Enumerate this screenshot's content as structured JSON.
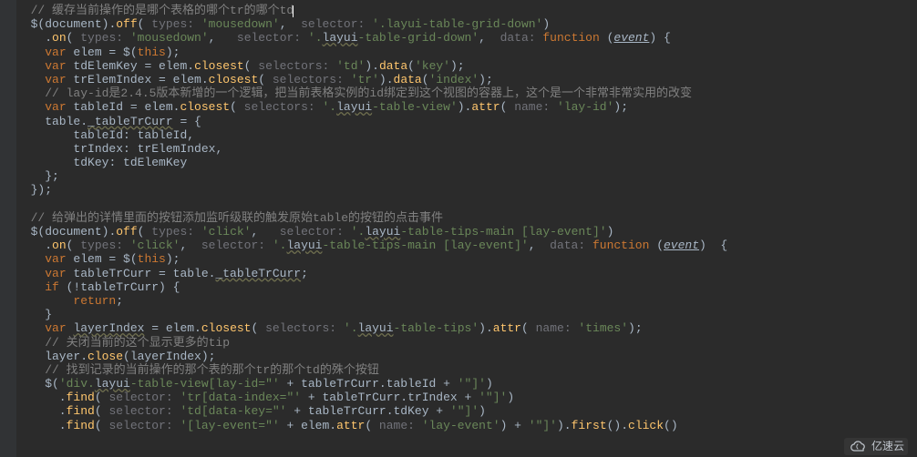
{
  "lines": [
    [
      [
        "  ",
        "id"
      ],
      [
        "// 缓存当前操作的是哪个表格的哪个tr的哪个td",
        "comment"
      ],
      [
        "",
        "cursor"
      ]
    ],
    [
      [
        "  $(",
        "id"
      ],
      [
        "document",
        "id"
      ],
      [
        ").",
        "id"
      ],
      [
        "off",
        "fn"
      ],
      [
        "( ",
        "id"
      ],
      [
        "types: ",
        "param"
      ],
      [
        "'mousedown'",
        "str"
      ],
      [
        ",  ",
        "id"
      ],
      [
        "selector: ",
        "param"
      ],
      [
        "'.layui-table-grid-down'",
        "str"
      ],
      [
        ")",
        "id"
      ]
    ],
    [
      [
        "    .",
        "id"
      ],
      [
        "on",
        "fn"
      ],
      [
        "( ",
        "id"
      ],
      [
        "types: ",
        "param"
      ],
      [
        "'mousedown'",
        "str"
      ],
      [
        ",   ",
        "id"
      ],
      [
        "selector: ",
        "param"
      ],
      [
        "'.",
        "str"
      ],
      [
        "layui",
        "warn"
      ],
      [
        "-table-grid-down'",
        "str"
      ],
      [
        ",  ",
        "id"
      ],
      [
        "data: ",
        "param"
      ],
      [
        "function",
        "kw"
      ],
      [
        " (",
        "id"
      ],
      [
        "event",
        "ev"
      ],
      [
        ") {",
        "id"
      ]
    ],
    [
      [
        "    ",
        "id"
      ],
      [
        "var",
        "kw"
      ],
      [
        " elem = $(",
        "id"
      ],
      [
        "this",
        "this"
      ],
      [
        ");",
        "id"
      ]
    ],
    [
      [
        "    ",
        "id"
      ],
      [
        "var",
        "kw"
      ],
      [
        " tdElemKey = elem.",
        "id"
      ],
      [
        "closest",
        "fn"
      ],
      [
        "( ",
        "id"
      ],
      [
        "selectors: ",
        "param"
      ],
      [
        "'td'",
        "str"
      ],
      [
        ").",
        "id"
      ],
      [
        "data",
        "fn"
      ],
      [
        "(",
        "id"
      ],
      [
        "'key'",
        "str"
      ],
      [
        ");",
        "id"
      ]
    ],
    [
      [
        "    ",
        "id"
      ],
      [
        "var",
        "kw"
      ],
      [
        " trElemIndex = elem.",
        "id"
      ],
      [
        "closest",
        "fn"
      ],
      [
        "( ",
        "id"
      ],
      [
        "selectors: ",
        "param"
      ],
      [
        "'tr'",
        "str"
      ],
      [
        ").",
        "id"
      ],
      [
        "data",
        "fn"
      ],
      [
        "(",
        "id"
      ],
      [
        "'index'",
        "str"
      ],
      [
        ");",
        "id"
      ]
    ],
    [
      [
        "    ",
        "id"
      ],
      [
        "// lay-id是2.4.5版本新增的一个逻辑，把当前表格实例的id绑定到这个视图的容器上，这个是一个非常非常实用的改变",
        "comment"
      ]
    ],
    [
      [
        "    ",
        "id"
      ],
      [
        "var",
        "kw"
      ],
      [
        " tableId = elem.",
        "id"
      ],
      [
        "closest",
        "fn"
      ],
      [
        "( ",
        "id"
      ],
      [
        "selectors: ",
        "param"
      ],
      [
        "'.",
        "str"
      ],
      [
        "layui",
        "warn"
      ],
      [
        "-table-view'",
        "str"
      ],
      [
        ").",
        "id"
      ],
      [
        "attr",
        "fn"
      ],
      [
        "( ",
        "id"
      ],
      [
        "name: ",
        "param"
      ],
      [
        "'lay-id'",
        "str"
      ],
      [
        ");",
        "id"
      ]
    ],
    [
      [
        "    table.",
        "id"
      ],
      [
        "_tableTrCurr",
        "warn"
      ],
      [
        " = {",
        "id"
      ]
    ],
    [
      [
        "        ",
        "id"
      ],
      [
        "tableId",
        "id"
      ],
      [
        ": tableId,",
        "id"
      ]
    ],
    [
      [
        "        ",
        "id"
      ],
      [
        "trIndex",
        "id"
      ],
      [
        ": trElemIndex,",
        "id"
      ]
    ],
    [
      [
        "        ",
        "id"
      ],
      [
        "tdKey",
        "id"
      ],
      [
        ": tdElemKey",
        "id"
      ]
    ],
    [
      [
        "    };",
        "id"
      ]
    ],
    [
      [
        "  });",
        "id"
      ]
    ],
    [
      [
        "",
        "id"
      ]
    ],
    [
      [
        "  ",
        "id"
      ],
      [
        "// 给弹出的详情里面的按钮添加监听级联的触发原始table的按钮的点击事件",
        "comment"
      ]
    ],
    [
      [
        "  $(",
        "id"
      ],
      [
        "document",
        "id"
      ],
      [
        ").",
        "id"
      ],
      [
        "off",
        "fn"
      ],
      [
        "( ",
        "id"
      ],
      [
        "types: ",
        "param"
      ],
      [
        "'click'",
        "str"
      ],
      [
        ",   ",
        "id"
      ],
      [
        "selector: ",
        "param"
      ],
      [
        "'.",
        "str"
      ],
      [
        "layui",
        "warn"
      ],
      [
        "-table-tips-main [lay-event]'",
        "str"
      ],
      [
        ")",
        "id"
      ]
    ],
    [
      [
        "    .",
        "id"
      ],
      [
        "on",
        "fn"
      ],
      [
        "( ",
        "id"
      ],
      [
        "types: ",
        "param"
      ],
      [
        "'click'",
        "str"
      ],
      [
        ",  ",
        "id"
      ],
      [
        "selector: ",
        "param"
      ],
      [
        "'.",
        "str"
      ],
      [
        "layui",
        "warn"
      ],
      [
        "-table-tips-main [lay-event]'",
        "str"
      ],
      [
        ",  ",
        "id"
      ],
      [
        "data: ",
        "param"
      ],
      [
        "function",
        "kw"
      ],
      [
        " (",
        "id"
      ],
      [
        "event",
        "ev"
      ],
      [
        ")  {",
        "id"
      ]
    ],
    [
      [
        "    ",
        "id"
      ],
      [
        "var",
        "kw"
      ],
      [
        " elem = $(",
        "id"
      ],
      [
        "this",
        "this"
      ],
      [
        ");",
        "id"
      ]
    ],
    [
      [
        "    ",
        "id"
      ],
      [
        "var",
        "kw"
      ],
      [
        " tableTrCurr = table.",
        "id"
      ],
      [
        "_tableTrCurr",
        "warn"
      ],
      [
        ";",
        "id"
      ]
    ],
    [
      [
        "    ",
        "id"
      ],
      [
        "if",
        "kw"
      ],
      [
        " (!tableTrCurr) {",
        "id"
      ]
    ],
    [
      [
        "        ",
        "id"
      ],
      [
        "return",
        "kw"
      ],
      [
        ";",
        "id"
      ]
    ],
    [
      [
        "    }",
        "id"
      ]
    ],
    [
      [
        "    ",
        "id"
      ],
      [
        "var",
        "kw"
      ],
      [
        " ",
        "id"
      ],
      [
        "layerIndex",
        "warn"
      ],
      [
        " = elem.",
        "id"
      ],
      [
        "closest",
        "fn"
      ],
      [
        "( ",
        "id"
      ],
      [
        "selectors: ",
        "param"
      ],
      [
        "'.",
        "str"
      ],
      [
        "layui",
        "warn"
      ],
      [
        "-table-tips'",
        "str"
      ],
      [
        ").",
        "id"
      ],
      [
        "attr",
        "fn"
      ],
      [
        "( ",
        "id"
      ],
      [
        "name: ",
        "param"
      ],
      [
        "'times'",
        "str"
      ],
      [
        ");",
        "id"
      ]
    ],
    [
      [
        "    ",
        "id"
      ],
      [
        "// 关闭当前的这个显示更多的tip",
        "comment"
      ]
    ],
    [
      [
        "    layer.",
        "id"
      ],
      [
        "close",
        "fn"
      ],
      [
        "(layerIndex);",
        "id"
      ]
    ],
    [
      [
        "    ",
        "id"
      ],
      [
        "// 找到记录的当前操作的那个表的那个tr的那个td的殊个按钮",
        "comment"
      ]
    ],
    [
      [
        "    $(",
        "id"
      ],
      [
        "'div.",
        "str"
      ],
      [
        "layui",
        "warn"
      ],
      [
        "-table-view[lay-id=\"'",
        "str"
      ],
      [
        " + tableTrCurr.tableId + ",
        "id"
      ],
      [
        "'\"]'",
        "str"
      ],
      [
        ")",
        "id"
      ]
    ],
    [
      [
        "      .",
        "id"
      ],
      [
        "find",
        "fn"
      ],
      [
        "( ",
        "id"
      ],
      [
        "selector: ",
        "param"
      ],
      [
        "'tr[data-index=\"'",
        "str"
      ],
      [
        " + tableTrCurr.trIndex + ",
        "id"
      ],
      [
        "'\"]'",
        "str"
      ],
      [
        ")",
        "id"
      ]
    ],
    [
      [
        "      .",
        "id"
      ],
      [
        "find",
        "fn"
      ],
      [
        "( ",
        "id"
      ],
      [
        "selector: ",
        "param"
      ],
      [
        "'td[data-key=\"'",
        "str"
      ],
      [
        " + tableTrCurr.tdKey + ",
        "id"
      ],
      [
        "'\"]'",
        "str"
      ],
      [
        ")",
        "id"
      ]
    ],
    [
      [
        "      .",
        "id"
      ],
      [
        "find",
        "fn"
      ],
      [
        "( ",
        "id"
      ],
      [
        "selector: ",
        "param"
      ],
      [
        "'[lay-event=\"'",
        "str"
      ],
      [
        " + elem.",
        "id"
      ],
      [
        "attr",
        "fn"
      ],
      [
        "( ",
        "id"
      ],
      [
        "name: ",
        "param"
      ],
      [
        "'lay-event'",
        "str"
      ],
      [
        ") + ",
        "id"
      ],
      [
        "'\"]'",
        "str"
      ],
      [
        ").",
        "id"
      ],
      [
        "first",
        "fn"
      ],
      [
        "().",
        "id"
      ],
      [
        "click",
        "fn"
      ],
      [
        "()",
        "id"
      ]
    ]
  ],
  "watermark": "亿速云"
}
